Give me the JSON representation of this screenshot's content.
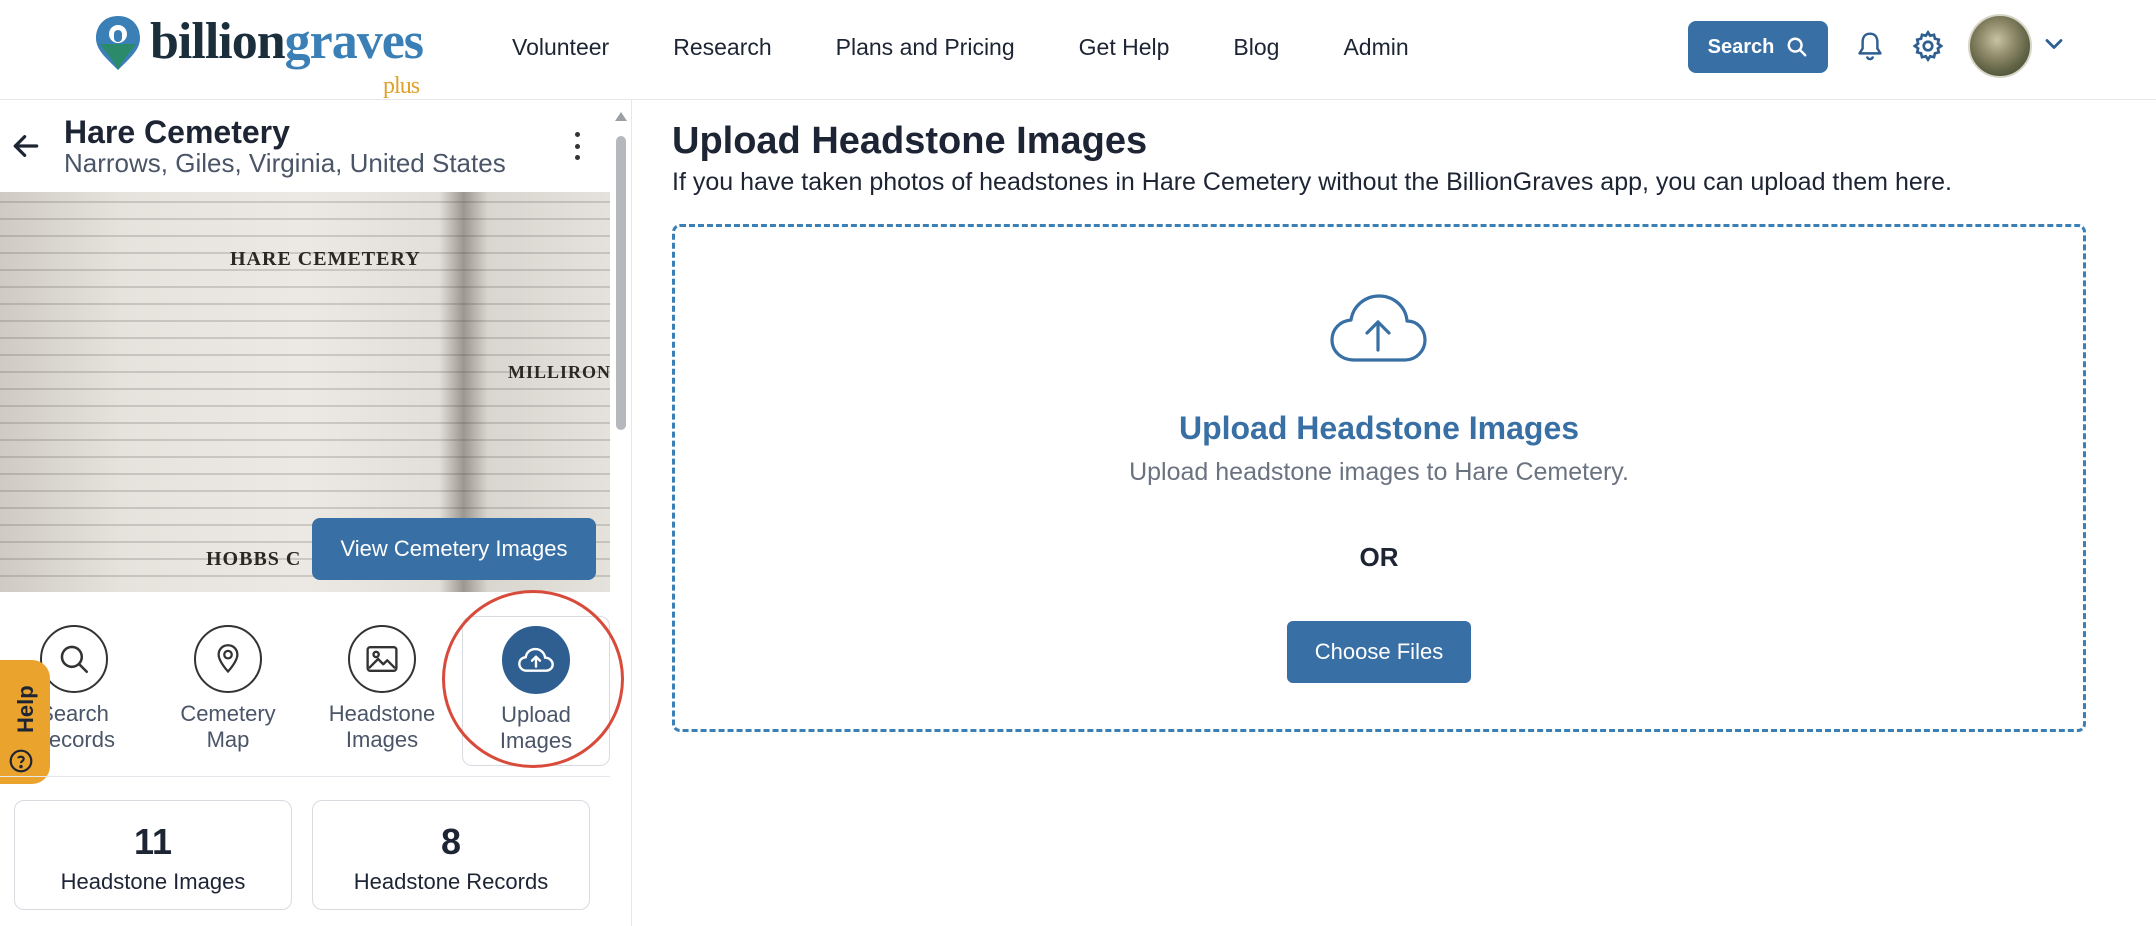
{
  "brand": {
    "name_part1": "billion",
    "name_part2": "graves",
    "tier": "plus",
    "colors": {
      "primary": "#386fa4",
      "accent": "#eaa32c",
      "dark": "#1a2e3b"
    }
  },
  "nav": {
    "items": [
      {
        "label": "Volunteer"
      },
      {
        "label": "Research"
      },
      {
        "label": "Plans and Pricing"
      },
      {
        "label": "Get Help"
      },
      {
        "label": "Blog"
      },
      {
        "label": "Admin"
      }
    ],
    "search_label": "Search",
    "icons": [
      "search-icon",
      "bell-icon",
      "gear-icon",
      "chevron-down-icon"
    ]
  },
  "cemetery": {
    "name": "Hare Cemetery",
    "location": "Narrows, Giles, Virginia, United States",
    "view_images_label": "View Cemetery Images",
    "photo_headings": {
      "title": "HARE CEMETERY",
      "right": "MILLIRON",
      "bottom": "HOBBS C"
    }
  },
  "help": {
    "label": "Help"
  },
  "tiles": [
    {
      "label_line1": "Search",
      "label_line2": "Records",
      "icon": "search-icon"
    },
    {
      "label_line1": "Cemetery",
      "label_line2": "Map",
      "icon": "map-pin-icon"
    },
    {
      "label_line1": "Headstone",
      "label_line2": "Images",
      "icon": "image-icon"
    },
    {
      "label_line1": "Upload",
      "label_line2": "Images",
      "icon": "cloud-upload-icon",
      "active": true
    }
  ],
  "stats": [
    {
      "value": "11",
      "label": "Headstone Images"
    },
    {
      "value": "8",
      "label": "Headstone Records"
    }
  ],
  "upload": {
    "title": "Upload Headstone Images",
    "subtitle": "If you have taken photos of headstones in Hare Cemetery without the BillionGraves app, you can upload them here.",
    "dropzone_title": "Upload Headstone Images",
    "dropzone_sub": "Upload headstone images to Hare Cemetery.",
    "or_label": "OR",
    "choose_label": "Choose Files"
  }
}
